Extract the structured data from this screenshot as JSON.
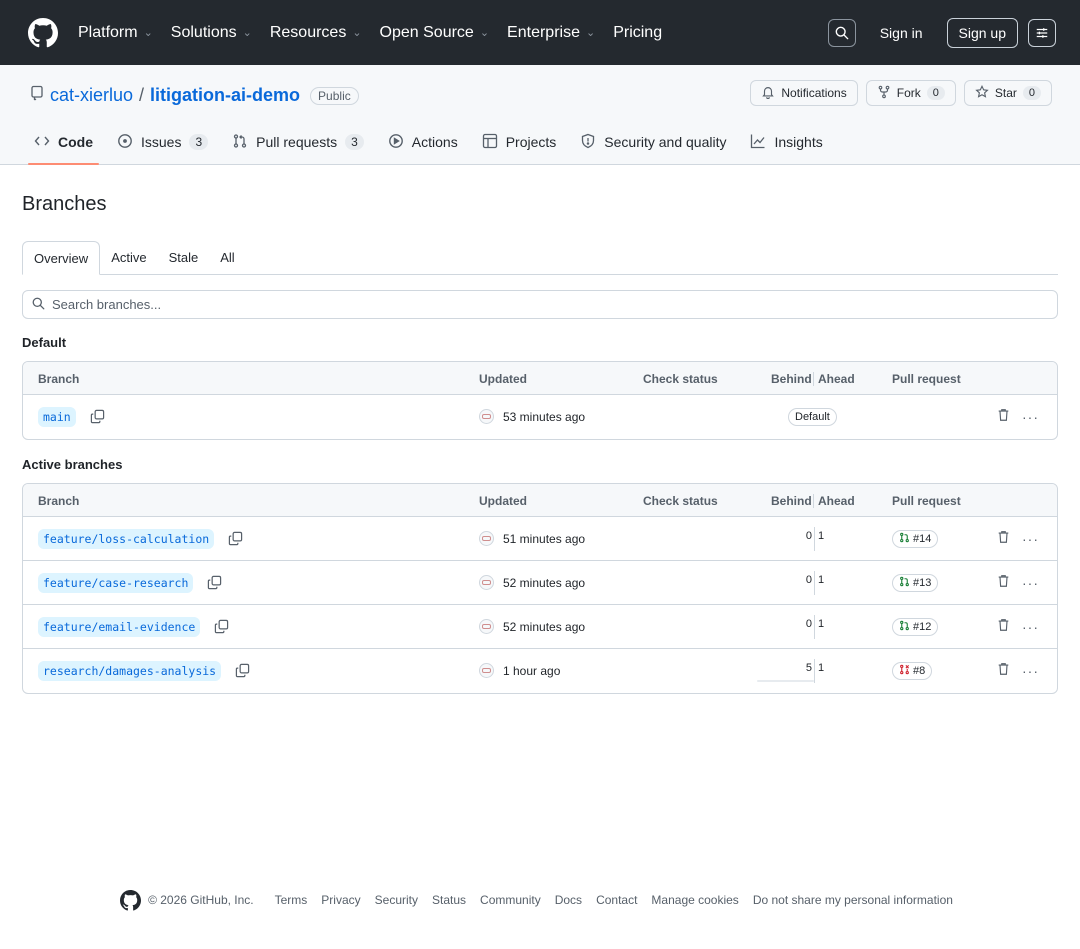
{
  "header": {
    "nav": [
      {
        "label": "Platform",
        "has_menu": true
      },
      {
        "label": "Solutions",
        "has_menu": true
      },
      {
        "label": "Resources",
        "has_menu": true
      },
      {
        "label": "Open Source",
        "has_menu": true
      },
      {
        "label": "Enterprise",
        "has_menu": true
      },
      {
        "label": "Pricing",
        "has_menu": false
      }
    ],
    "signin": "Sign in",
    "signup": "Sign up"
  },
  "repo": {
    "owner": "cat-xierluo",
    "slash": "/",
    "name": "litigation-ai-demo",
    "visibility": "Public",
    "notifications_label": "Notifications",
    "fork_label": "Fork",
    "fork_count": "0",
    "star_label": "Star",
    "star_count": "0",
    "tabs": [
      {
        "label": "Code",
        "count": null,
        "icon": "code-icon",
        "active": true
      },
      {
        "label": "Issues",
        "count": "3",
        "icon": "issue-icon",
        "active": false
      },
      {
        "label": "Pull requests",
        "count": "3",
        "icon": "pull-request-icon",
        "active": false
      },
      {
        "label": "Actions",
        "count": null,
        "icon": "play-icon",
        "active": false
      },
      {
        "label": "Projects",
        "count": null,
        "icon": "table-icon",
        "active": false
      },
      {
        "label": "Security and quality",
        "count": null,
        "icon": "shield-icon",
        "active": false
      },
      {
        "label": "Insights",
        "count": null,
        "icon": "graph-icon",
        "active": false
      }
    ]
  },
  "page": {
    "title": "Branches",
    "subtabs": [
      "Overview",
      "Active",
      "Stale",
      "All"
    ],
    "active_subtab": "Overview",
    "search_placeholder": "Search branches..."
  },
  "columns": {
    "branch": "Branch",
    "updated": "Updated",
    "check": "Check status",
    "behind_ahead": "Behind",
    "ahead": "Ahead",
    "pr": "Pull request"
  },
  "default_section": {
    "title": "Default",
    "rows": [
      {
        "branch": "main",
        "updated": "53 minutes ago",
        "badge": "Default"
      }
    ]
  },
  "active_section": {
    "title": "Active branches",
    "rows": [
      {
        "branch": "feature/loss-calculation",
        "updated": "51 minutes ago",
        "behind": "0",
        "ahead": "1",
        "pr": "#14",
        "pr_state": "open"
      },
      {
        "branch": "feature/case-research",
        "updated": "52 minutes ago",
        "behind": "0",
        "ahead": "1",
        "pr": "#13",
        "pr_state": "open"
      },
      {
        "branch": "feature/email-evidence",
        "updated": "52 minutes ago",
        "behind": "0",
        "ahead": "1",
        "pr": "#12",
        "pr_state": "open"
      },
      {
        "branch": "research/damages-analysis",
        "updated": "1 hour ago",
        "behind": "5",
        "ahead": "1",
        "pr": "#8",
        "pr_state": "closed"
      }
    ]
  },
  "footer": {
    "copyright": "© 2026 GitHub, Inc.",
    "links": [
      "Terms",
      "Privacy",
      "Security",
      "Status",
      "Community",
      "Docs",
      "Contact",
      "Manage cookies",
      "Do not share my personal information"
    ]
  },
  "colors": {
    "header_bg": "#24292f",
    "link": "#0969da",
    "tab_underline": "#fd8c73",
    "pr_open": "#1a7f37",
    "pr_closed": "#cf222e"
  }
}
